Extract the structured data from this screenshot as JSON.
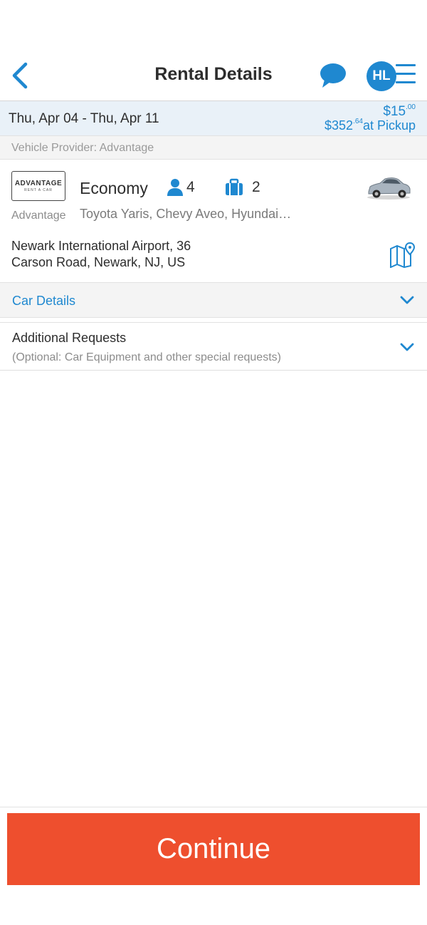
{
  "header": {
    "title": "Rental Details",
    "avatar_initials": "HL",
    "icons": {
      "back": "chevron-left-icon",
      "chat": "chat-bubble-icon",
      "menu": "hamburger-menu-icon"
    },
    "accent_color": "#1f88d0"
  },
  "trip": {
    "date_range": "Thu, Apr 04 - Thu, Apr 11",
    "price_main": "$15",
    "price_main_cents": ".00",
    "price_pickup": "$352",
    "price_pickup_cents": ".64",
    "price_pickup_suffix": "at Pickup"
  },
  "provider": {
    "line": "Vehicle Provider: Advantage"
  },
  "car": {
    "logo_text": "ADVANTAGE",
    "logo_subtext": "RENT A CAR",
    "vendor": "Advantage",
    "class": "Economy",
    "seats": "4",
    "bags": "2",
    "models": "Toyota Yaris, Chevy Aveo, Hyundai…",
    "address_line1": "Newark International Airport, 36",
    "address_line2": "Carson Road, Newark, NJ, US",
    "icons": {
      "seats": "person-icon",
      "bags": "suitcase-icon",
      "map": "map-pin-icon"
    }
  },
  "sections": {
    "car_details_label": "Car Details",
    "requests_title": "Additional Requests",
    "requests_subtitle": "(Optional: Car Equipment and other special requests)"
  },
  "footer": {
    "continue_label": "Continue",
    "button_color": "#ee4f2e"
  }
}
